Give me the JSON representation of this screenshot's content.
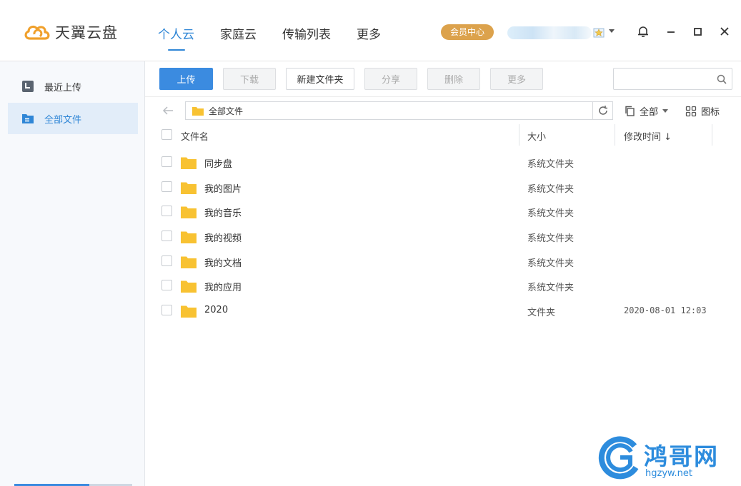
{
  "app": {
    "logo_text": "天翼云盘"
  },
  "nav": {
    "items": [
      {
        "label": "个人云"
      },
      {
        "label": "家庭云"
      },
      {
        "label": "传输列表"
      },
      {
        "label": "更多"
      }
    ]
  },
  "header": {
    "vip_label": "会员中心"
  },
  "sidebar": {
    "items": [
      {
        "label": "最近上传"
      },
      {
        "label": "全部文件"
      }
    ]
  },
  "toolbar": {
    "upload": "上传",
    "download": "下载",
    "new_folder": "新建文件夹",
    "share": "分享",
    "delete": "删除",
    "more": "更多",
    "search_placeholder": ""
  },
  "path": {
    "current": "全部文件",
    "filter_label": "全部",
    "view_label": "图标"
  },
  "table": {
    "headers": {
      "name": "文件名",
      "size": "大小",
      "time": "修改时间 ↓"
    },
    "rows": [
      {
        "name": "同步盘",
        "type": "系统文件夹",
        "mtime": ""
      },
      {
        "name": "我的图片",
        "type": "系统文件夹",
        "mtime": ""
      },
      {
        "name": "我的音乐",
        "type": "系统文件夹",
        "mtime": ""
      },
      {
        "name": "我的视频",
        "type": "系统文件夹",
        "mtime": ""
      },
      {
        "name": "我的文档",
        "type": "系统文件夹",
        "mtime": ""
      },
      {
        "name": "我的应用",
        "type": "系统文件夹",
        "mtime": ""
      },
      {
        "name": "2020",
        "type": "文件夹",
        "mtime": "2020-08-01 12:03"
      }
    ]
  },
  "watermark": {
    "title": "鸿哥网",
    "url": "hgzyw.net"
  },
  "colors": {
    "accent": "#2f86d6",
    "primary_button": "#3b8be0",
    "vip": "#dca24c",
    "folder": "#f8c232"
  }
}
